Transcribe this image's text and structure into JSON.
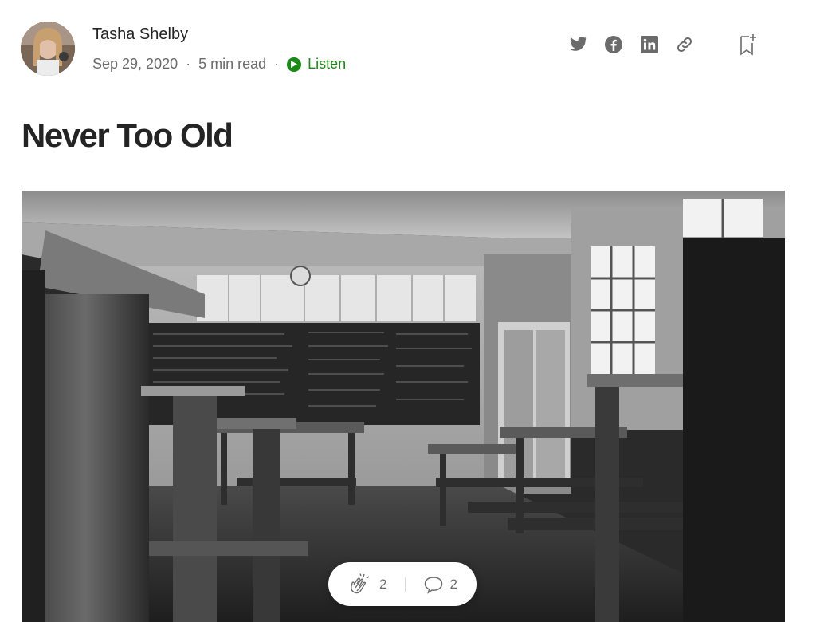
{
  "author": {
    "name": "Tasha Shelby",
    "avatar_icon": "author-avatar-photo"
  },
  "meta": {
    "date": "Sep 29, 2020",
    "separator": "·",
    "read_time": "5 min read",
    "listen_label": "Listen"
  },
  "share": {
    "icons": [
      "twitter-icon",
      "facebook-icon",
      "linkedin-icon",
      "link-icon",
      "bookmark-add-icon"
    ]
  },
  "article": {
    "title": "Never Too Old",
    "hero_image_description_icon": "classroom-photo"
  },
  "actions": {
    "clap_count": "2",
    "response_count": "2"
  },
  "colors": {
    "listen_green": "#1a8917",
    "text_primary": "#242424",
    "text_secondary": "#6b6b6b",
    "icon_gray": "#6b6b6b"
  }
}
